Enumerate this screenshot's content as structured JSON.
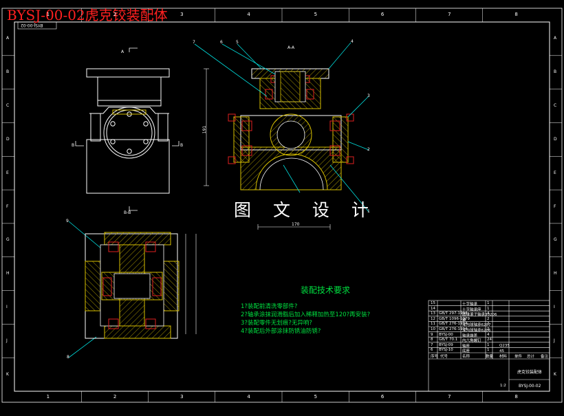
{
  "drawing_title": "BYSJ-00-02虎克铰装配体",
  "code_top_stamp": "BYSJ-00-02",
  "watermark": "图 文 设 计",
  "border": {
    "top_numbers": [
      "1",
      "2",
      "3",
      "4",
      "5",
      "6",
      "7",
      "8"
    ],
    "bottom_numbers": [
      "1",
      "2",
      "3",
      "4",
      "5",
      "6",
      "7",
      "8"
    ],
    "side_letters": [
      "A",
      "B",
      "C",
      "D",
      "E",
      "F",
      "G",
      "H",
      "I",
      "J",
      "K"
    ]
  },
  "views": {
    "section_aa": "A-A",
    "view_a_mark": "A",
    "view_b_mark": "B",
    "section_bb": "B-B"
  },
  "leaders": [
    "7",
    "6",
    "5",
    "4",
    "3",
    "2",
    "1",
    "9",
    "8"
  ],
  "dimensions": {
    "height_main": "191",
    "width_bottom": "170"
  },
  "requirements": {
    "title": "装配技术要求",
    "items": [
      "1?装配前清洗零部件?",
      "2?轴承涂抹润滑脂后加入稀释加热至120?再安装?",
      "3?装配零件无划痕?无异响?",
      "4?装配后外部涂抹防锈油防锈?"
    ]
  },
  "title_block": {
    "drawing_no": "BYSJ-00-02",
    "name": "虎克铰装配体",
    "rows": [
      {
        "no": "15",
        "code": "",
        "name": "十字轴承",
        "qty": "1"
      },
      {
        "no": "14",
        "code": "",
        "name": "十字轴承座",
        "qty": "1"
      },
      {
        "no": "13",
        "code": "GB/T 297-1994",
        "name": "圆锥滚子轴承30206",
        "qty": "4"
      },
      {
        "no": "12",
        "code": "GB/T 1096-1979",
        "name": "键",
        "qty": "2"
      },
      {
        "no": "11",
        "code": "GB/T 276-1994",
        "name": "深沟球轴承6207",
        "qty": "2"
      },
      {
        "no": "10",
        "code": "GB/T 276-1994",
        "name": "深沟球轴承6206",
        "qty": "2"
      },
      {
        "no": "9",
        "code": "BYSJ-00",
        "name": "轴承端盖",
        "qty": "4"
      },
      {
        "no": "8",
        "code": "GB/T 70.1",
        "name": "内六角螺钉",
        "qty": "24"
      },
      {
        "no": "7",
        "code": "BYSJ-09",
        "name": "轴座",
        "qty": "1"
      },
      {
        "no": "6",
        "code": "BYSJ-10",
        "name": "底座",
        "qty": "1"
      }
    ],
    "materials": [
      "Q235",
      "45"
    ],
    "header": [
      "序号",
      "代号",
      "名称",
      "数量",
      "材料",
      "单件",
      "总计",
      "备注"
    ],
    "scale": "1:2"
  }
}
